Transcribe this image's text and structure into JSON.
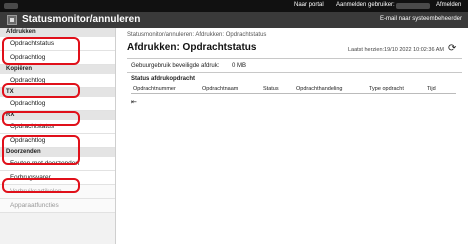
{
  "topbar": {
    "portal_label": "Naar portal",
    "login_label": "Aanmelden gebruiker:",
    "logout_label": "Afmelden"
  },
  "header": {
    "title": "Statusmonitor/annuleren",
    "email_link": "E-mail naar systeembeheerder"
  },
  "sidebar": {
    "sections": [
      {
        "title": "Afdrukken",
        "items": [
          "Opdrachtstatus",
          "Opdrachtlog"
        ]
      },
      {
        "title": "Kopiëren",
        "items": [
          "Opdrachtlog"
        ]
      },
      {
        "title": "TX",
        "items": [
          "Opdrachtlog"
        ]
      },
      {
        "title": "RX",
        "items": [
          "Opdrachtstatus",
          "Opdrachtlog"
        ]
      },
      {
        "title": "Doorzenden",
        "items": [
          "Fouten met doorzenden"
        ]
      }
    ],
    "extra_items": [
      "Forbrugsvarer",
      "Verbruiksartikelen",
      "Apparaatfuncties"
    ]
  },
  "main": {
    "breadcrumb": "Statusmonitor/annuleren: Afdrukken: Opdrachtstatus",
    "title": "Afdrukken: Opdrachtstatus",
    "last_updated": "Laatst herzien:19/10 2022 10:02:36 AM",
    "memory_label": "Gebuurgebruik beveiligde afdruk:",
    "memory_value": "0 MB",
    "status_label": "Status afdrukopdracht",
    "columns": [
      "Opdrachtnummer",
      "Opdrachtnaam",
      "Status",
      "Opdrachthandeling",
      "Type opdracht",
      "Tijd"
    ]
  }
}
